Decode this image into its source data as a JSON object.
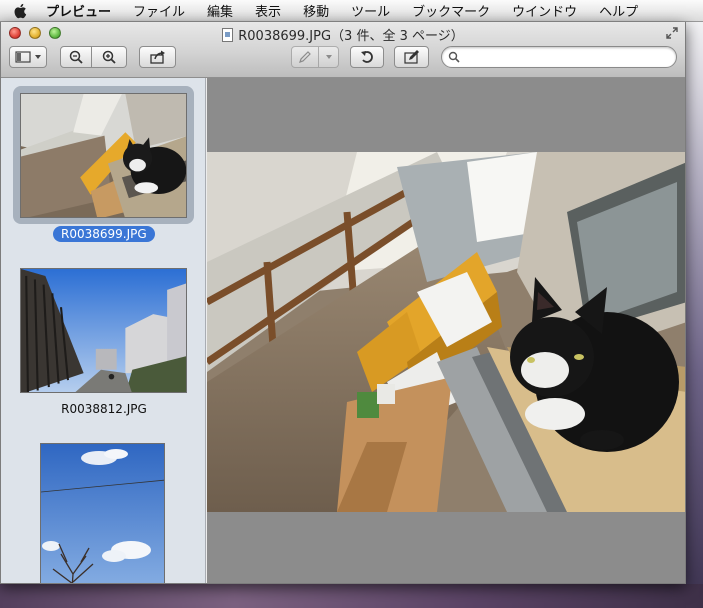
{
  "menubar": {
    "apple_icon": "apple-icon",
    "items": [
      "プレビュー",
      "ファイル",
      "編集",
      "表示",
      "移動",
      "ツール",
      "ブックマーク",
      "ウインドウ",
      "ヘルプ"
    ]
  },
  "window": {
    "title": "R0038699.JPG（3 件、全 3 ページ）",
    "toolbar": {
      "view_menu_icon": "sidebar-toggle-icon",
      "zoom_out_icon": "zoom-out-icon",
      "zoom_in_icon": "zoom-in-icon",
      "share_icon": "share-icon",
      "markup_icon": "pencil-icon",
      "rotate_icon": "rotate-left-icon",
      "edit_icon": "signature-icon",
      "search_icon": "search-icon",
      "search_value": "",
      "search_placeholder": ""
    }
  },
  "sidebar": {
    "thumbnails": [
      {
        "filename": "R0038699.JPG",
        "selected": true
      },
      {
        "filename": "R0038812.JPG",
        "selected": false
      },
      {
        "filename": "",
        "selected": false
      }
    ]
  },
  "colors": {
    "selection": "#3a76d6",
    "sidebar_bg": "#dde3ea",
    "canvas_bg": "#8c8c8c"
  }
}
